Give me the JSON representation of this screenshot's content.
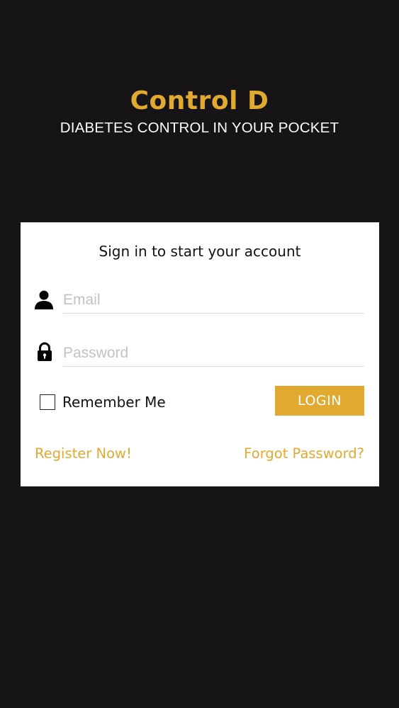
{
  "brand": {
    "title": "Control D",
    "tagline": "DIABETES CONTROL IN YOUR POCKET"
  },
  "login_card": {
    "heading": "Sign in to start your account",
    "email": {
      "placeholder": "Email",
      "value": "",
      "icon": "user-icon"
    },
    "password": {
      "placeholder": "Password",
      "value": "",
      "icon": "lock-icon"
    },
    "remember_me": {
      "label": "Remember Me",
      "checked": false
    },
    "login_label": "LOGIN",
    "register_link": "Register Now!",
    "forgot_link": "Forgot Password?"
  },
  "colors": {
    "background": "#161416",
    "accent": "#e2a930",
    "card": "#ffffff"
  }
}
